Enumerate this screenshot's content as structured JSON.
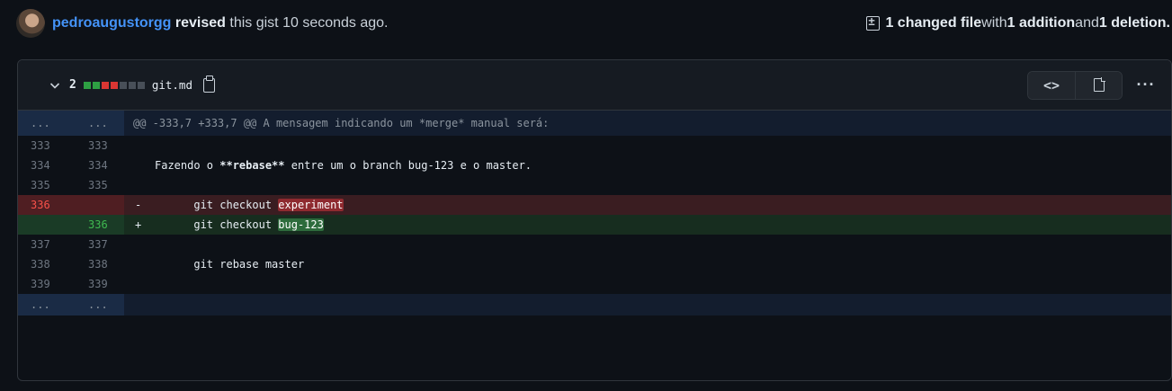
{
  "revision": {
    "user": "pedroaugustorgg",
    "action": "revised",
    "rest": " this gist 10 seconds ago.",
    "changed_files": "1 changed file",
    "with": " with ",
    "additions": "1 addition",
    "and": " and ",
    "deletions": "1 deletion."
  },
  "file": {
    "change_count": "2",
    "name": "git.md",
    "blocks": [
      "#2ea043",
      "#2ea043",
      "#da3633",
      "#da3633",
      "#484f58",
      "#484f58",
      "#484f58"
    ]
  },
  "icons": {
    "chevron": "chevron-down-icon",
    "copy": "copy-icon",
    "code_view": "code-icon",
    "file_view": "file-icon",
    "more": "kebab-icon"
  },
  "diff": {
    "hunk": {
      "old": "...",
      "new": "...",
      "text": "@@ -333,7 +333,7 @@ A mensagem indicando um *merge* manual será:"
    },
    "lines": [
      {
        "type": "ctx",
        "old": "333",
        "new": "333",
        "text": ""
      },
      {
        "type": "ctx",
        "old": "334",
        "new": "334",
        "text_pre": "Fazendo o ",
        "text_bold": "**rebase**",
        "text_post": " entre um o branch bug-123 e o master."
      },
      {
        "type": "ctx",
        "old": "335",
        "new": "335",
        "text": ""
      },
      {
        "type": "del",
        "old": "336",
        "new": "",
        "sign": "-",
        "text_pre": "      git checkout ",
        "text_hl": "experiment"
      },
      {
        "type": "add",
        "old": "",
        "new": "336",
        "sign": "+",
        "text_pre": "      git checkout ",
        "text_hl": "bug-123"
      },
      {
        "type": "ctx",
        "old": "337",
        "new": "337",
        "text": ""
      },
      {
        "type": "ctx",
        "old": "338",
        "new": "338",
        "text": "      git rebase master"
      },
      {
        "type": "ctx",
        "old": "339",
        "new": "339",
        "text": ""
      }
    ],
    "end_hunk": {
      "old": "...",
      "new": "..."
    }
  }
}
